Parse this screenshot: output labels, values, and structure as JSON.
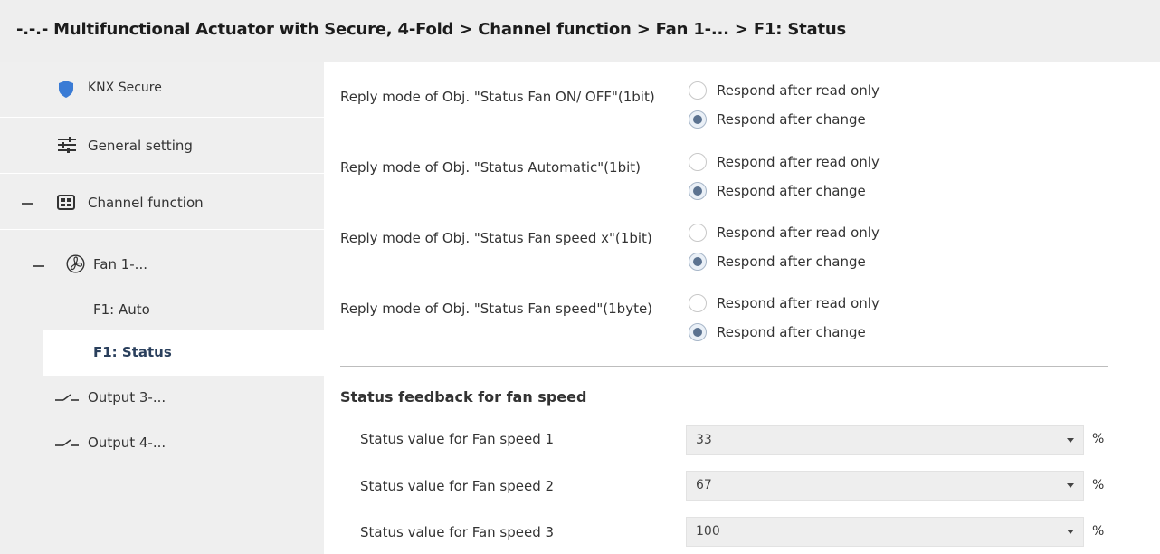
{
  "header": {
    "breadcrumb": "-.-.- Multifunctional Actuator with Secure, 4-Fold > Channel function > Fan 1-... > F1: Status"
  },
  "sidebar": {
    "items": [
      {
        "label": "KNX Secure",
        "icon": "shield-icon"
      },
      {
        "label": "General setting",
        "icon": "sliders-icon"
      },
      {
        "label": "Channel function",
        "icon": "grid-panel-icon",
        "expanded": true
      },
      {
        "label": "Fan 1-...",
        "icon": "fan-icon",
        "expanded": true
      },
      {
        "label": "F1: Auto"
      },
      {
        "label": "F1: Status",
        "selected": true
      },
      {
        "label": "Output 3-...",
        "icon": "switch-icon"
      },
      {
        "label": "Output 4-...",
        "icon": "switch-icon"
      }
    ]
  },
  "main": {
    "params": [
      {
        "label": "Reply mode of Obj. \"Status Fan ON/ OFF\"(1bit)",
        "options": [
          "Respond after read only",
          "Respond after change"
        ],
        "selected": 1
      },
      {
        "label": "Reply mode of Obj. \"Status Automatic\"(1bit)",
        "options": [
          "Respond after read only",
          "Respond after change"
        ],
        "selected": 1
      },
      {
        "label": "Reply mode of Obj. \"Status Fan speed x\"(1bit)",
        "options": [
          "Respond after read only",
          "Respond after change"
        ],
        "selected": 1
      },
      {
        "label": "Reply mode of Obj. \"Status Fan speed\"(1byte)",
        "options": [
          "Respond after read only",
          "Respond after change"
        ],
        "selected": 1
      }
    ],
    "section_title": "Status feedback for fan speed",
    "speed_fields": [
      {
        "label": "Status value for Fan speed 1",
        "value": "33",
        "unit": "%"
      },
      {
        "label": "Status value for Fan speed 2",
        "value": "67",
        "unit": "%"
      },
      {
        "label": "Status value for Fan speed 3",
        "value": "100",
        "unit": "%"
      }
    ]
  },
  "colors": {
    "sidebar_bg": "#efefef",
    "title_bg": "#eeeeee",
    "shield": "#3a7bd5",
    "radio_dot": "#5b7290"
  }
}
